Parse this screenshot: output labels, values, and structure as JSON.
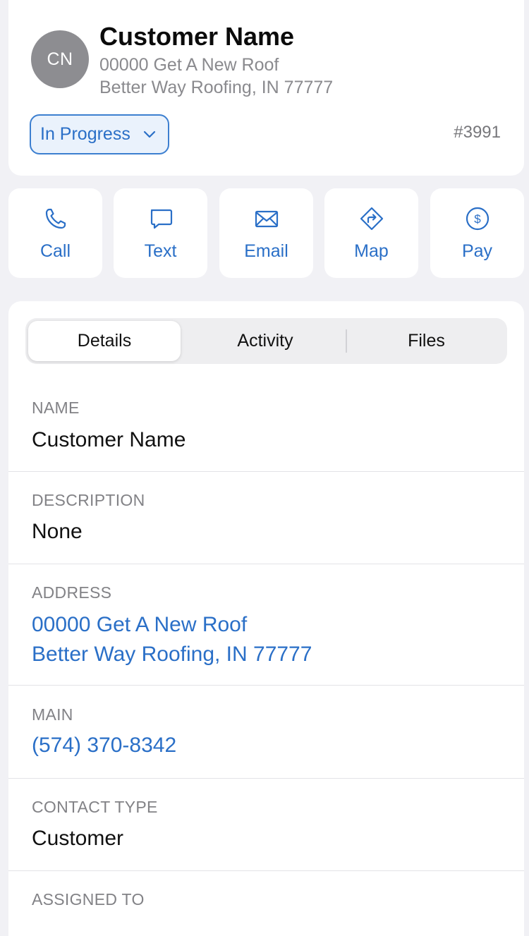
{
  "header": {
    "avatar_initials": "CN",
    "customer_name": "Customer Name",
    "address_line1": "00000 Get A New Roof",
    "address_line2": "Better Way Roofing, IN 77777",
    "status": "In Progress",
    "job_number": "#3991"
  },
  "actions": [
    {
      "label": "Call",
      "icon": "phone-icon"
    },
    {
      "label": "Text",
      "icon": "message-icon"
    },
    {
      "label": "Email",
      "icon": "envelope-icon"
    },
    {
      "label": "Map",
      "icon": "directions-icon"
    },
    {
      "label": "Pay",
      "icon": "dollar-icon"
    }
  ],
  "tabs": [
    {
      "label": "Details",
      "active": true
    },
    {
      "label": "Activity",
      "active": false
    },
    {
      "label": "Files",
      "active": false
    }
  ],
  "fields": {
    "name": {
      "label": "NAME",
      "value": "Customer Name"
    },
    "description": {
      "label": "DESCRIPTION",
      "value": "None"
    },
    "address": {
      "label": "ADDRESS",
      "line1": "00000 Get A New Roof",
      "line2": "Better Way Roofing, IN 77777"
    },
    "main": {
      "label": "MAIN",
      "value": "(574) 370-8342"
    },
    "contact_type": {
      "label": "CONTACT TYPE",
      "value": "Customer"
    },
    "assigned_to": {
      "label": "ASSIGNED TO"
    }
  },
  "colors": {
    "accent": "#2a6fc7",
    "background": "#f1f1f5",
    "secondary_text": "#8a8a8e"
  }
}
